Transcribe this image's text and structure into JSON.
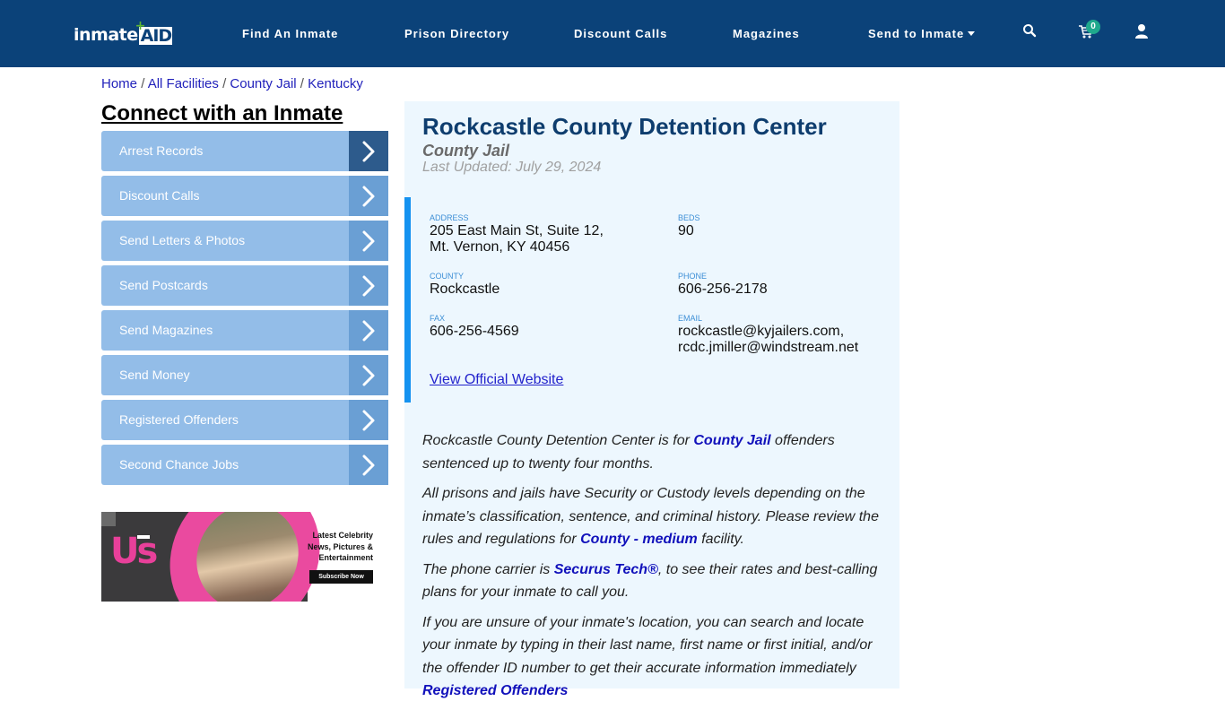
{
  "header": {
    "logo": {
      "part1": "inmate",
      "part2": "AID",
      "plus": "+"
    },
    "nav": [
      {
        "label": "Find An Inmate"
      },
      {
        "label": "Prison Directory"
      },
      {
        "label": "Discount Calls"
      },
      {
        "label": "Magazines"
      },
      {
        "label": "Send to Inmate",
        "dropdown": true
      }
    ],
    "icons": {
      "search": "search-icon",
      "cart": "cart-icon",
      "user": "user-icon"
    },
    "cart_count": "0"
  },
  "breadcrumb": [
    {
      "label": "Home"
    },
    {
      "label": "All Facilities"
    },
    {
      "label": "County Jail"
    },
    {
      "label": "Kentucky"
    }
  ],
  "breadcrumb_separator": "/",
  "sidebar": {
    "title": "Connect with an Inmate",
    "items": [
      {
        "label": "Arrest Records"
      },
      {
        "label": "Discount Calls"
      },
      {
        "label": "Send Letters & Photos"
      },
      {
        "label": "Send Postcards"
      },
      {
        "label": "Send Magazines"
      },
      {
        "label": "Send Money"
      },
      {
        "label": "Registered Offenders"
      },
      {
        "label": "Second Chance Jobs"
      }
    ],
    "ad": {
      "brand": "Us",
      "headline": "Latest Celebrity News, Pictures & Entertainment",
      "cta": "Subscribe Now"
    }
  },
  "facility": {
    "name": "Rockcastle County Detention Center",
    "type": "County Jail",
    "last_updated": "Last Updated: July 29, 2024",
    "address_label": "ADDRESS",
    "address_line1": "205 East Main St, Suite 12,",
    "address_line2": "Mt. Vernon, KY 40456",
    "beds_label": "BEDS",
    "beds": "90",
    "county_label": "COUNTY",
    "county": "Rockcastle",
    "phone_label": "PHONE",
    "phone": "606-256-2178",
    "fax_label": "FAX",
    "fax": "606-256-4569",
    "email_label": "EMAIL",
    "email1": "rockcastle@kyjailers.com,",
    "email2": "rcdc.jmiller@windstream.net",
    "website_label": "View Official Website"
  },
  "description": {
    "p1_a": "Rockcastle County Detention Center is for ",
    "p1_link": "County Jail",
    "p1_b": " offenders sentenced up to twenty four months.",
    "p2_a": "All prisons and jails have Security or Custody levels depending on the inmate’s classification, sentence, and criminal history. Please review the rules and regulations for ",
    "p2_link": "County - medium",
    "p2_b": " facility.",
    "p3_a": "The phone carrier is ",
    "p3_link": "Securus Tech®",
    "p3_b": ", to see their rates and best-calling plans for your inmate to call you.",
    "p4_a": "If you are unsure of your inmate's location, you can search and locate your inmate by typing in their last name, first name or first initial, and/or the offender ID number to get their accurate information immediately ",
    "p4_link": "Registered Offenders"
  },
  "colors": {
    "header_bg": "#0b4279",
    "sidebar_item": "#93bde8",
    "sidebar_arrow": "#6a9fd4",
    "sidebar_arrow_active": "#2d5b8c",
    "main_bg": "#edf7fe",
    "accent_bar": "#1592f0",
    "title": "#0e3d6e",
    "badge": "#1fa98d"
  }
}
